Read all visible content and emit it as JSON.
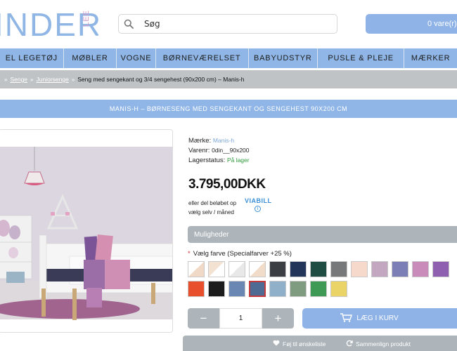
{
  "header": {
    "logo_text": "INDER",
    "logo_side_text": "LEE",
    "search_value": "Søg",
    "cart_label": "0 vare(r) -"
  },
  "nav": {
    "items": [
      "EL LEGETØJ",
      "MØBLER",
      "VOGNE",
      "BØRNEVÆRELSET",
      "BABYUDSTYR",
      "PUSLE & PLEJE",
      "MÆRKER"
    ]
  },
  "breadcrumb": {
    "items": [
      "Senge",
      "Juniorsenge"
    ],
    "current": "Seng med sengekant og 3/4 sengehest (90x200 cm) – Manis-h"
  },
  "product": {
    "title": "MANIS-H – BØRNESENG MED SENGEKANT OG SENGEHEST 90X200 CM",
    "brand_label": "Mærke:",
    "brand_value": "Manis-h",
    "sku_label": "Varenr:",
    "sku_value": "0din__90x200",
    "stock_label": "Lagerstatus:",
    "stock_value": "På lager",
    "price": "3.795,00DKK",
    "finance_line1": "eller del beløbet op",
    "finance_line2": "vælg selv / måned",
    "viabill_logo": "VIABILL",
    "viabill_info": "i",
    "options_header": "Muligheder",
    "color_label": "Vælg farve (Specialfarver +25 %)",
    "required_star": "*",
    "quantity": "1",
    "minus_label": "−",
    "plus_label": "+",
    "add_to_cart": "LÆG I KURV",
    "wishlist": "Føj til ønskeliste",
    "compare": "Sammenlign produkt"
  },
  "colors": {
    "accent": "#8fb6e6",
    "gray_bar": "#aeb5ba",
    "swatches_row1": [
      "#ffffff/#f1d9c7",
      "#f3e2d2/#ffffff",
      "#ffffff/#e8e8e8",
      "#ffffff/#f0dcc9",
      "#3b3f44",
      "#23365a",
      "#1f4d44",
      "#76787a",
      "#f7d9cc",
      "#c3a6c0",
      "#7c7fb6",
      "#c98bb9",
      "#8f5fb0"
    ],
    "swatches_row2": [
      "#e8502d",
      "#1c1c1c",
      "#6a86b3",
      "#4f6a93",
      "#8fb0c8",
      "#7f9b80",
      "#3f9a56",
      "#ead468"
    ]
  }
}
